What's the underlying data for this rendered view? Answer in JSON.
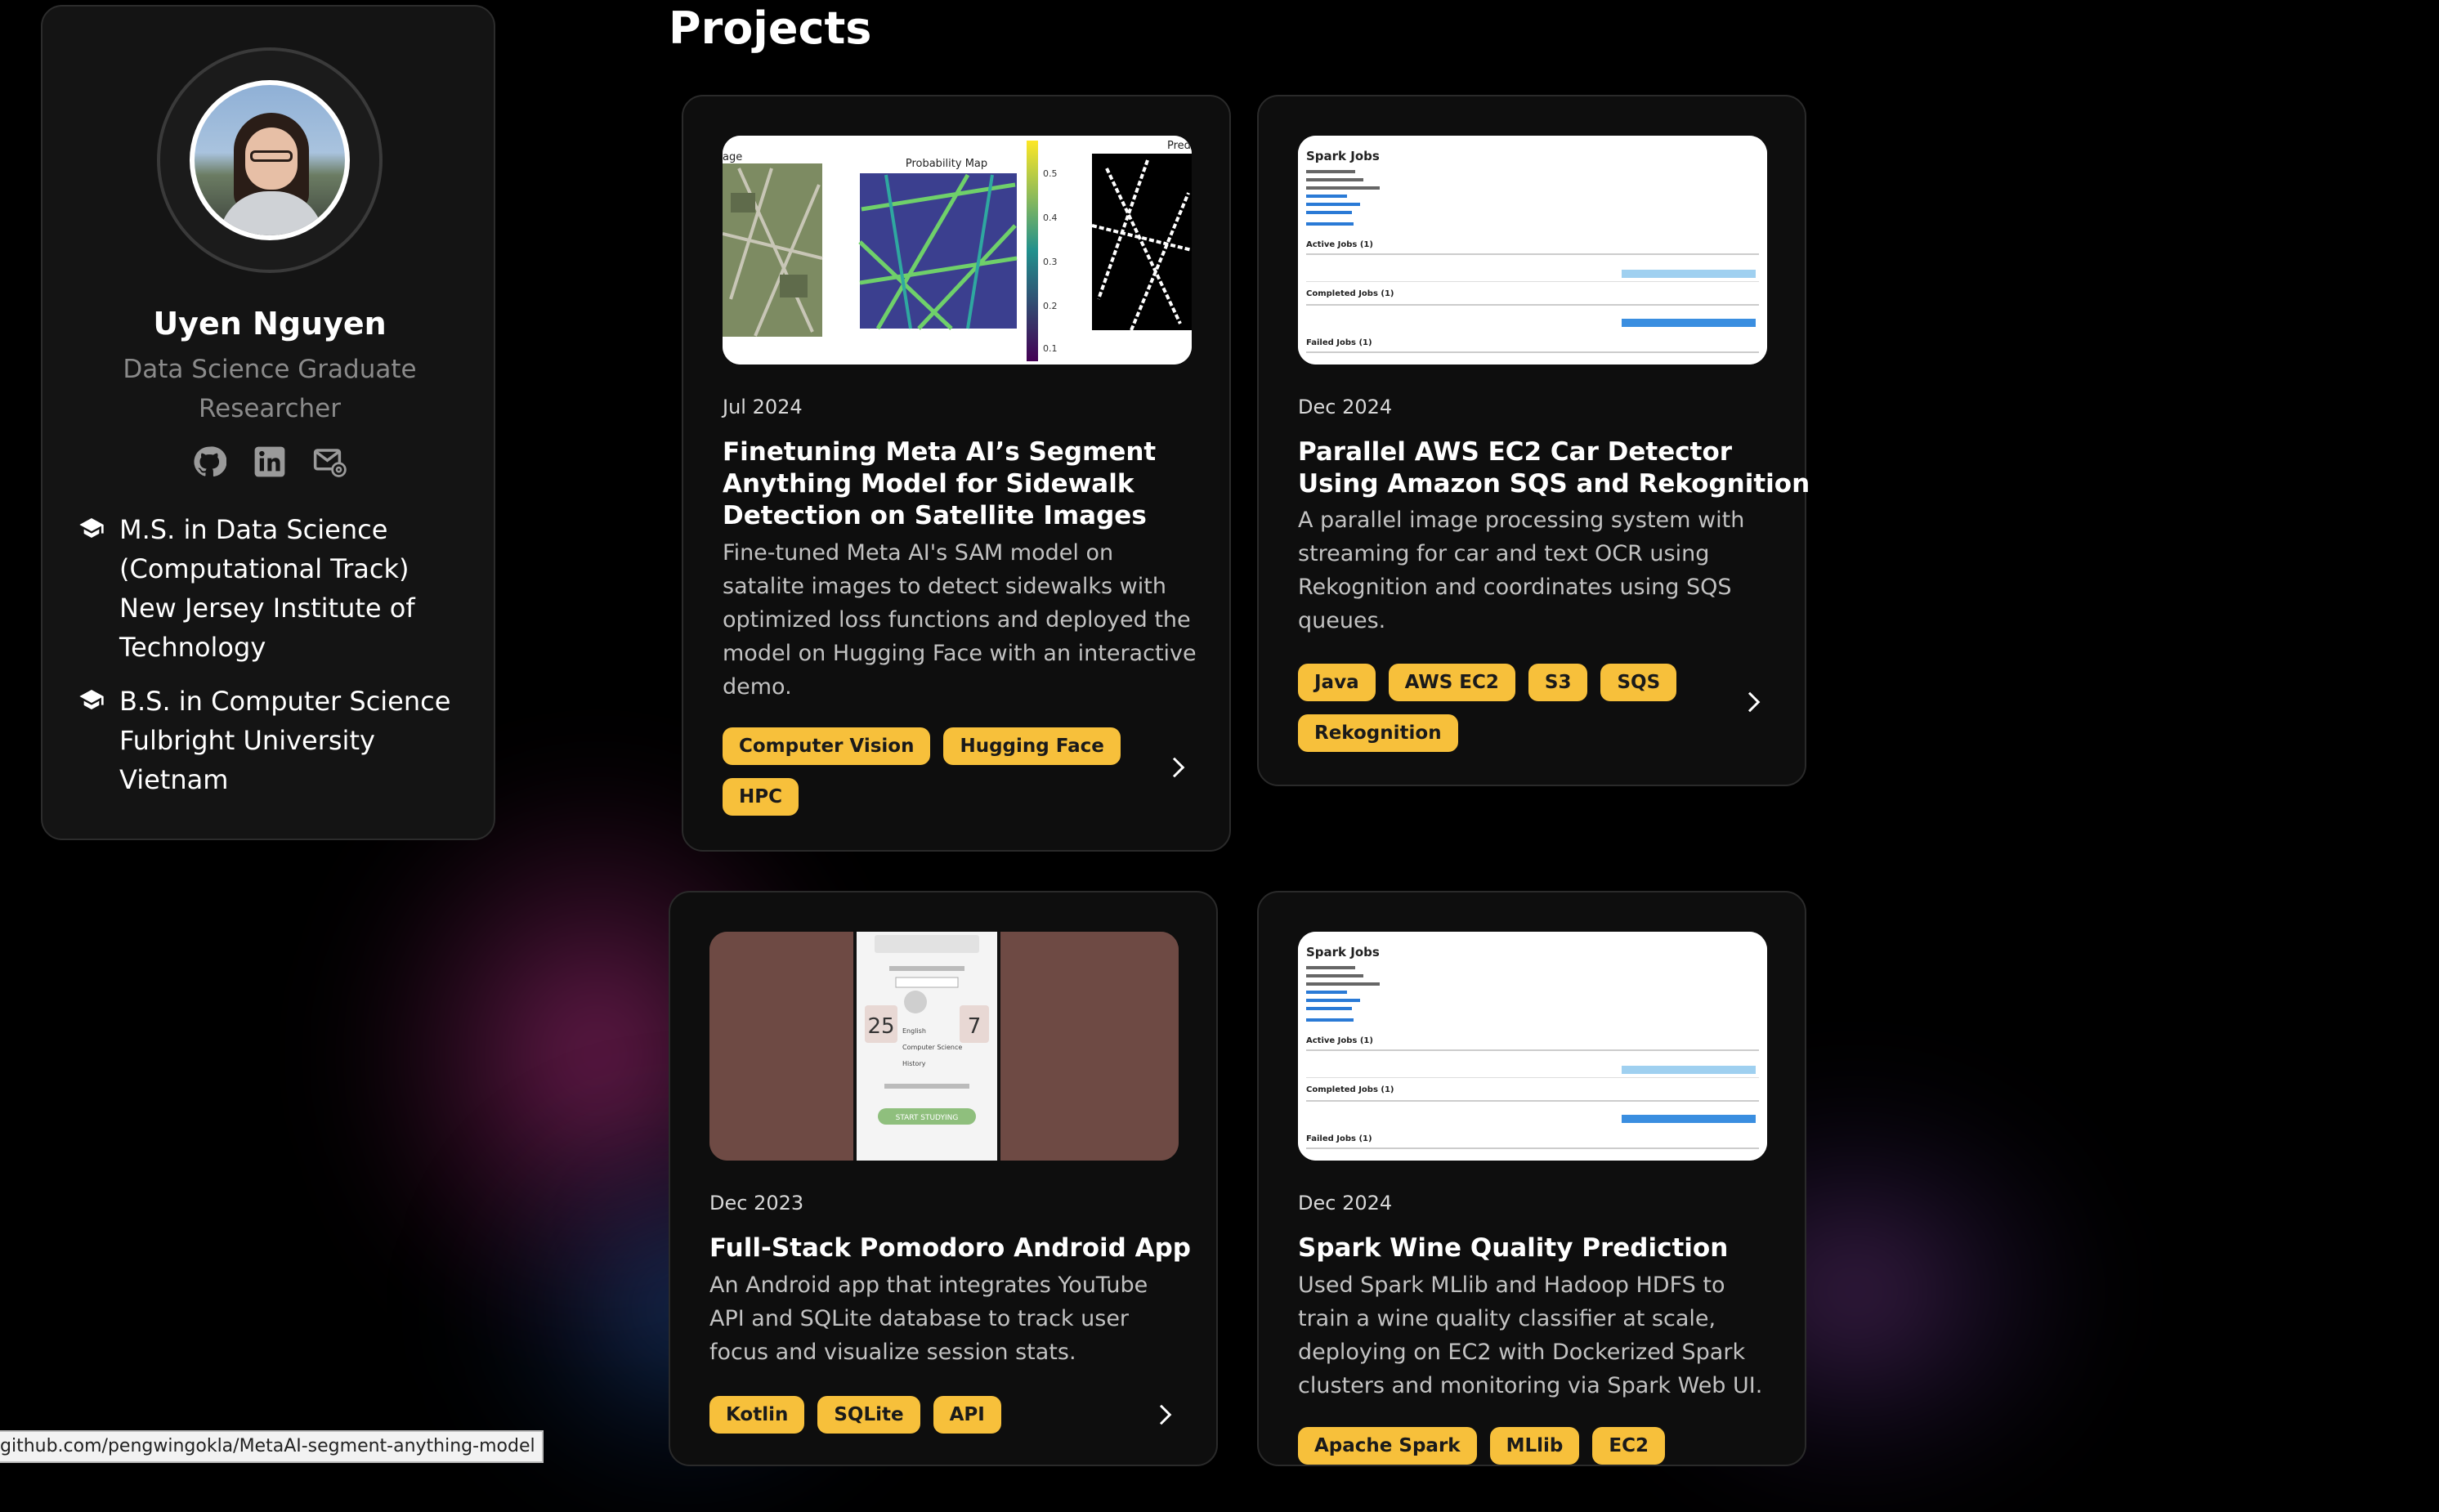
{
  "profile": {
    "name": "Uyen Nguyen",
    "title": "Data Science Graduate Researcher",
    "social": [
      "github-icon",
      "linkedin-icon",
      "email-icon"
    ],
    "education": [
      {
        "lines": [
          "M.S. in Data Science",
          "(Computational Track)",
          "New Jersey Institute of",
          "Technology"
        ]
      },
      {
        "lines": [
          "B.S. in Computer Science",
          "Fulbright University",
          "Vietnam"
        ]
      }
    ]
  },
  "section_title": "Projects",
  "projects": [
    {
      "date": "Jul 2024",
      "title_lines": [
        "Finetuning Meta AI’s Segment",
        "Anything Model for Sidewalk",
        "Detection on Satellite Images"
      ],
      "desc_lines": [
        "Fine-tuned Meta AI's SAM model on",
        "satalite images to detect sidewalks with",
        "optimized loss functions and deployed the",
        "model on Hugging Face with an interactive",
        "demo."
      ],
      "tags": [
        "Computer Vision",
        "Hugging Face",
        "HPC"
      ],
      "thumb": {
        "label_left": "age",
        "label_center": "Probability Map",
        "label_right": "Pred",
        "colorbar_ticks": [
          "0.5",
          "0.4",
          "0.3",
          "0.2",
          "0.1"
        ]
      }
    },
    {
      "date": "Dec 2024",
      "title_lines": [
        "Parallel AWS EC2 Car Detector",
        "Using Amazon SQS and Rekognition"
      ],
      "desc_lines": [
        "A parallel image processing system with",
        "streaming for car and text OCR using",
        "Rekognition and coordinates using SQS",
        "queues."
      ],
      "tags": [
        "Java",
        "AWS EC2",
        "S3",
        "SQS",
        "Rekognition"
      ],
      "thumb": {
        "heading": "Spark Jobs",
        "sections": [
          "Active Jobs (1)",
          "Completed Jobs (1)",
          "Failed Jobs (1)"
        ]
      }
    },
    {
      "date": "Dec 2023",
      "title_lines": [
        "Full-Stack Pomodoro Android App"
      ],
      "desc_lines": [
        "An Android app that integrates YouTube",
        "API and SQLite database to track user",
        "focus and visualize session stats."
      ],
      "tags": [
        "Kotlin",
        "SQLite",
        "API"
      ],
      "thumb": {
        "num_left": "25",
        "num_right": "7",
        "items": [
          "English",
          "Computer Science",
          "History"
        ],
        "button": "START STUDYING"
      }
    },
    {
      "date": "Dec 2024",
      "title_lines": [
        "Spark Wine Quality Prediction"
      ],
      "desc_lines": [
        "Used Spark MLlib and Hadoop HDFS to",
        "train a wine quality classifier at scale,",
        "deploying on EC2 with Dockerized Spark",
        "clusters and monitoring via Spark Web UI."
      ],
      "tags": [
        "Apache Spark",
        "MLlib",
        "EC2"
      ],
      "thumb": {
        "heading": "Spark Jobs",
        "sections": [
          "Active Jobs (1)",
          "Completed Jobs (1)",
          "Failed Jobs (1)"
        ]
      }
    }
  ],
  "status_url": "github.com/pengwingokla/MetaAI-segment-anything-model",
  "colors": {
    "background": "#000000",
    "card": "#0e0e0e",
    "tag": "#f7c03b",
    "muted": "#8a8a8a"
  }
}
